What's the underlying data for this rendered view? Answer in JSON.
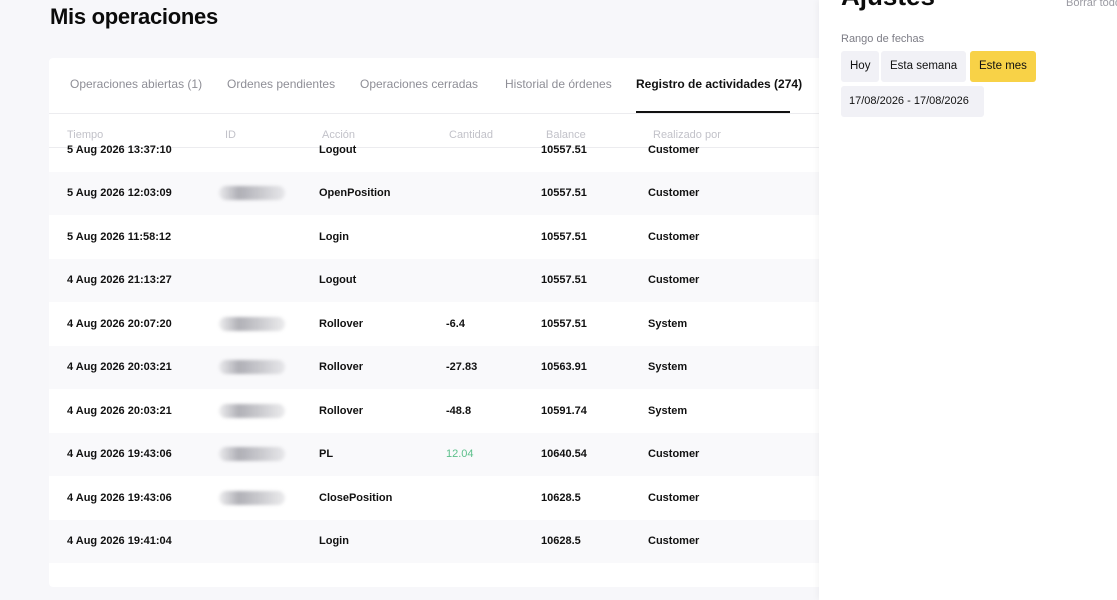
{
  "page": {
    "title": "Mis operaciones"
  },
  "tabs": [
    {
      "label": "Operaciones abiertas (1)",
      "active": false
    },
    {
      "label": "Ordenes pendientes",
      "active": false
    },
    {
      "label": "Operaciones cerradas",
      "active": false
    },
    {
      "label": "Historial de órdenes",
      "active": false
    },
    {
      "label": "Registro de actividades (274)",
      "active": true
    }
  ],
  "table": {
    "columns": [
      "Tiempo",
      "ID",
      "Acción",
      "Cantidad",
      "Balance",
      "Realizado por"
    ],
    "rows": [
      {
        "time": "5 Aug 2026 13:37:10",
        "id_redacted": false,
        "action": "Logout",
        "amount": "",
        "balance": "10557.51",
        "by": "Customer"
      },
      {
        "time": "5 Aug 2026 12:03:09",
        "id_redacted": true,
        "action": "OpenPosition",
        "amount": "",
        "balance": "10557.51",
        "by": "Customer"
      },
      {
        "time": "5 Aug 2026 11:58:12",
        "id_redacted": false,
        "action": "Login",
        "amount": "",
        "balance": "10557.51",
        "by": "Customer"
      },
      {
        "time": "4 Aug 2026 21:13:27",
        "id_redacted": false,
        "action": "Logout",
        "amount": "",
        "balance": "10557.51",
        "by": "Customer"
      },
      {
        "time": "4 Aug 2026 20:07:20",
        "id_redacted": true,
        "action": "Rollover",
        "amount": "-6.4",
        "balance": "10557.51",
        "by": "System"
      },
      {
        "time": "4 Aug 2026 20:03:21",
        "id_redacted": true,
        "action": "Rollover",
        "amount": "-27.83",
        "balance": "10563.91",
        "by": "System"
      },
      {
        "time": "4 Aug 2026 20:03:21",
        "id_redacted": true,
        "action": "Rollover",
        "amount": "-48.8",
        "balance": "10591.74",
        "by": "System"
      },
      {
        "time": "4 Aug 2026 19:43:06",
        "id_redacted": true,
        "action": "PL",
        "amount": "12.04",
        "amount_positive": true,
        "balance": "10640.54",
        "by": "Customer"
      },
      {
        "time": "4 Aug 2026 19:43:06",
        "id_redacted": true,
        "action": "ClosePosition",
        "amount": "",
        "balance": "10628.5",
        "by": "Customer"
      },
      {
        "time": "4 Aug 2026 19:41:04",
        "id_redacted": false,
        "action": "Login",
        "amount": "",
        "balance": "10628.5",
        "by": "Customer"
      }
    ]
  },
  "settings": {
    "title": "Ajustes",
    "clear_label": "Borrar todo",
    "date_range_label": "Rango de fechas",
    "chips": [
      {
        "label": "Hoy",
        "selected": false
      },
      {
        "label": "Esta semana",
        "selected": false
      },
      {
        "label": "Este mes",
        "selected": true
      }
    ],
    "date_range_value": "17/08/2026 - 17/08/2026"
  },
  "colors": {
    "accent": "#f8d247",
    "positive": "#5bbf8a",
    "text": "#111111",
    "muted": "#8e8e96"
  }
}
